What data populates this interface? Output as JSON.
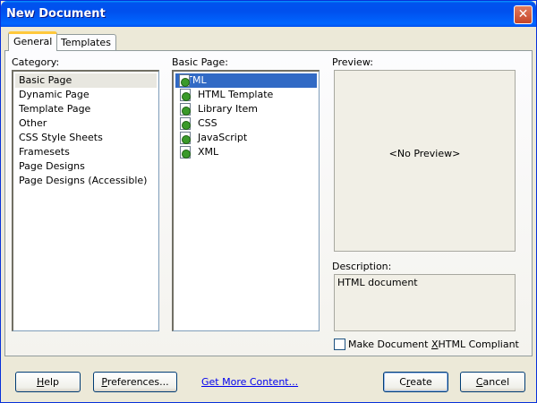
{
  "window": {
    "title": "New Document",
    "close_glyph": "✕"
  },
  "tabs": [
    {
      "label": "General",
      "active": true
    },
    {
      "label": "Templates",
      "active": false
    }
  ],
  "category": {
    "label": "Category:",
    "items": [
      "Basic Page",
      "Dynamic Page",
      "Template Page",
      "Other",
      "CSS Style Sheets",
      "Framesets",
      "Page Designs",
      "Page Designs (Accessible)"
    ],
    "selected": "Basic Page"
  },
  "basic_page": {
    "label": "Basic Page:",
    "items": [
      "HTML",
      "HTML Template",
      "Library Item",
      "CSS",
      "JavaScript",
      "XML"
    ],
    "selected": "HTML",
    "icon": "dreamweaver-document-icon"
  },
  "preview": {
    "label": "Preview:",
    "placeholder": "<No Preview>"
  },
  "description": {
    "label": "Description:",
    "text": "HTML document"
  },
  "xhtml_checkbox": {
    "label_pre": "Make Document ",
    "label_key": "X",
    "label_post": "HTML Compliant",
    "checked": false
  },
  "buttons": {
    "help": {
      "pre": "",
      "key": "H",
      "post": "elp"
    },
    "preferences": {
      "pre": "",
      "key": "P",
      "post": "references..."
    },
    "get_more_content": "Get More Content...",
    "create": {
      "pre": "C",
      "key": "r",
      "post": "eate"
    },
    "cancel": {
      "pre": "",
      "key": "C",
      "post": "ancel"
    }
  },
  "colors": {
    "titlebar": "#0054e3",
    "dialog_bg": "#ece9d8",
    "selection": "#316ac5",
    "link": "#0000ee"
  }
}
